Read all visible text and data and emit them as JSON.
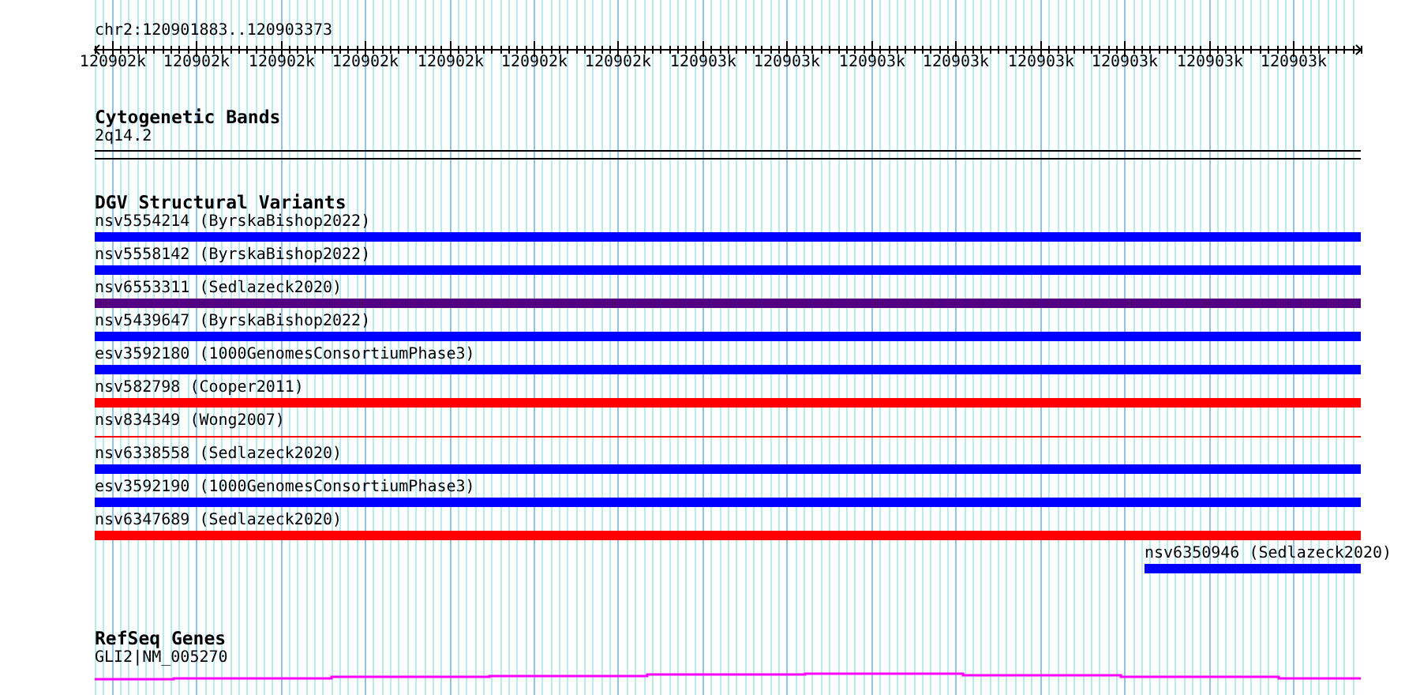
{
  "ruler": {
    "location": "chr2:120901883..120903373",
    "tick_labels": [
      "120902k",
      "120902k",
      "120902k",
      "120902k",
      "120902k",
      "120902k",
      "120902k",
      "120903k",
      "120903k",
      "120903k",
      "120903k",
      "120903k",
      "120903k",
      "120903k",
      "120903k"
    ]
  },
  "tracks": [
    {
      "kind": "cytoband",
      "title": "Cytogenetic Bands",
      "features": [
        {
          "label": "2q14.2"
        }
      ]
    },
    {
      "kind": "variants",
      "title": "DGV Structural Variants",
      "features": [
        {
          "label": "nsv5554214 (ByrskaBishop2022)",
          "color": "#0000ff",
          "kind": "bar"
        },
        {
          "label": "nsv5558142 (ByrskaBishop2022)",
          "color": "#0000ff",
          "kind": "bar"
        },
        {
          "label": "nsv6553311 (Sedlazeck2020)",
          "color": "#500080",
          "kind": "bar"
        },
        {
          "label": "nsv5439647 (ByrskaBishop2022)",
          "color": "#0000ff",
          "kind": "bar"
        },
        {
          "label": "esv3592180 (1000GenomesConsortiumPhase3)",
          "color": "#0000ff",
          "kind": "bar"
        },
        {
          "label": "nsv582798 (Cooper2011)",
          "color": "#ff0000",
          "kind": "bar"
        },
        {
          "label": "nsv834349 (Wong2007)",
          "color": "#ff0000",
          "kind": "line"
        },
        {
          "label": "nsv6338558 (Sedlazeck2020)",
          "color": "#0000ff",
          "kind": "bar"
        },
        {
          "label": "esv3592190 (1000GenomesConsortiumPhase3)",
          "color": "#0000ff",
          "kind": "bar"
        },
        {
          "label": "nsv6347689 (Sedlazeck2020)",
          "color": "#ff0000",
          "kind": "bar"
        },
        {
          "label": "nsv6350946 (Sedlazeck2020)",
          "color": "#0000ff",
          "kind": "end-bar"
        }
      ]
    },
    {
      "kind": "gene",
      "title": "RefSeq Genes",
      "features": [
        {
          "label": "GLI2|NM_005270"
        }
      ]
    }
  ]
}
